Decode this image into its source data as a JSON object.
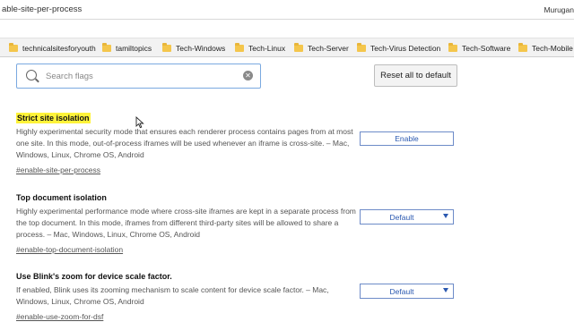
{
  "address": {
    "url": "able-site-per-process",
    "profile": "Murugan"
  },
  "bookmarks": [
    {
      "label": "technicalsitesforyouth"
    },
    {
      "label": "tamiltopics"
    },
    {
      "label": "Tech-Windows"
    },
    {
      "label": "Tech-Linux"
    },
    {
      "label": "Tech-Server"
    },
    {
      "label": "Tech-Virus Detection"
    },
    {
      "label": "Tech-Software"
    },
    {
      "label": "Tech-Mobile"
    }
  ],
  "search": {
    "placeholder": "Search flags",
    "value": ""
  },
  "reset_label": "Reset all to default",
  "flags": [
    {
      "title": "Strict site isolation",
      "description": "Highly experimental security mode that ensures each renderer process contains pages from at most one site. In this mode, out-of-process iframes will be used whenever an iframe is cross-site. – Mac, Windows, Linux, Chrome OS, Android",
      "link": "#enable-site-per-process",
      "control": "Enable"
    },
    {
      "title": "Top document isolation",
      "description": "Highly experimental performance mode where cross-site iframes are kept in a separate process from the top document. In this mode, iframes from different third-party sites will be allowed to share a process. – Mac, Windows, Linux, Chrome OS, Android",
      "link": "#enable-top-document-isolation",
      "control": "Default"
    },
    {
      "title": "Use Blink's zoom for device scale factor.",
      "description": "If enabled, Blink uses its zooming mechanism to scale content for device scale factor. – Mac, Windows, Linux, Chrome OS, Android",
      "link": "#enable-use-zoom-for-dsf",
      "control": "Default"
    }
  ],
  "colors": {
    "highlight": "#fff33a",
    "accent": "#2a58b0",
    "folder": "#f4c64c"
  }
}
